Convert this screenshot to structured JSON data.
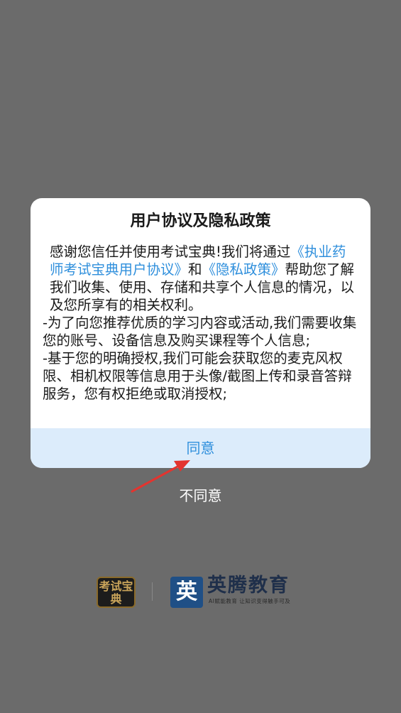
{
  "dialog": {
    "title": "用户协议及隐私政策",
    "body": {
      "p1_text1": "感谢您信任并使用考试宝典!我们将通过",
      "p1_link1": "《执业药师考试宝典用户协议》",
      "p1_text2": "和",
      "p1_link2": "《隐私政策》",
      "p1_text3": "帮助您了解我们收集、使用、存储和共享个人信息的情况，以及您所享有的相关权利。",
      "p2": "-为了向您推荐优质的学习内容或活动,我们需要收集您的账号、设备信息及购买课程等个人信息;",
      "p3": "-基于您的明确授权,我们可能会获取您的麦克风权限、相机权限等信息用于头像/截图上传和录音答辩服务，您有权拒绝或取消授权;"
    },
    "agree_label": "同意"
  },
  "disagree_label": "不同意",
  "footer": {
    "logo_ksbd_text": "考试宝典",
    "ying_logo_char": "英",
    "brand_name": "英腾教育",
    "brand_slogan": "AI赋能教育  让知识变得触手可及"
  },
  "colors": {
    "overlay": "#6b6b6b",
    "link": "#2f8fdc",
    "agree_bg": "#dcecfb",
    "arrow": "#e3342f"
  },
  "icons": {
    "annotation_arrow": "red-arrow-icon"
  }
}
